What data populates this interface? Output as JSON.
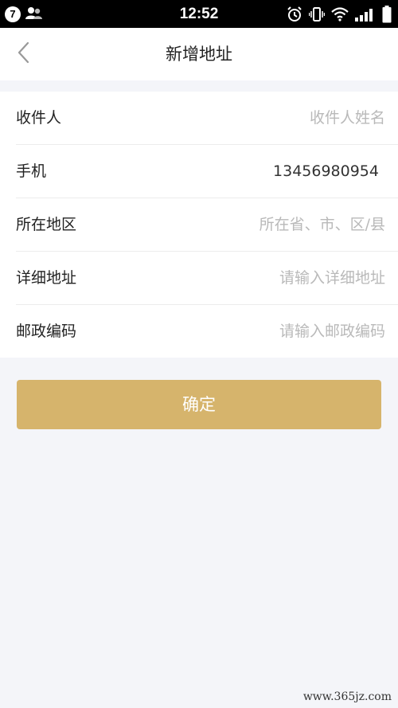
{
  "status_bar": {
    "notification_count": "7",
    "time": "12:52"
  },
  "header": {
    "title": "新增地址"
  },
  "form": {
    "recipient": {
      "label": "收件人",
      "placeholder": "收件人姓名",
      "value": ""
    },
    "phone": {
      "label": "手机",
      "value": "13456980954"
    },
    "region": {
      "label": "所在地区",
      "placeholder": "所在省、市、区/县"
    },
    "address": {
      "label": "详细地址",
      "placeholder": "请输入详细地址"
    },
    "postcode": {
      "label": "邮政编码",
      "placeholder": "请输入邮政编码"
    }
  },
  "confirm_label": "确定",
  "watermark": "www.365jz.com",
  "colors": {
    "accent": "#d6b46c",
    "background": "#f4f5f9"
  }
}
